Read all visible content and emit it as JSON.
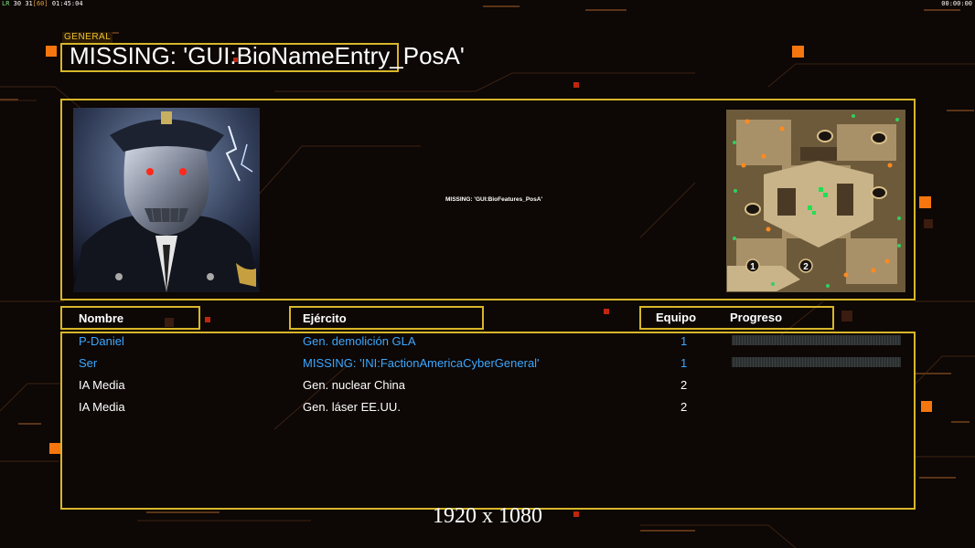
{
  "hud": {
    "fps_prefix": "LR",
    "fps_a": "30",
    "fps_b": "31",
    "fps_c": "[60]",
    "clock": "01:45:04",
    "timer": "00:00:00"
  },
  "general_tag": "GENERAL",
  "title": "MISSING: 'GUI:BioNameEntry_PosA'",
  "bio_features": "MISSING: 'GUI:BioFeatures_PosA'",
  "columns": {
    "name": "Nombre",
    "army": "Ejército",
    "team": "Equipo",
    "progress": "Progreso"
  },
  "players": [
    {
      "name": "P-Daniel",
      "army": "Gen. demolición GLA",
      "team": "1",
      "progress": 0,
      "color": "#3ba8ff"
    },
    {
      "name": "Ser",
      "army": "MISSING: 'INI:FactionAmericaCyberGeneral'",
      "team": "1",
      "progress": 0,
      "color": "#3ba8ff"
    },
    {
      "name": "IA Media",
      "army": "Gen. nuclear China",
      "team": "2",
      "color": "#ffffff"
    },
    {
      "name": "IA Media",
      "army": "Gen. láser EE.UU.",
      "team": "2",
      "color": "#ffffff"
    }
  ],
  "map": {
    "start_labels": [
      "1",
      "2"
    ]
  },
  "resolution": "1920 x 1080",
  "colors": {
    "frame": "#d8b62a",
    "player": "#3ba8ff",
    "accent": "#ff6a10"
  }
}
